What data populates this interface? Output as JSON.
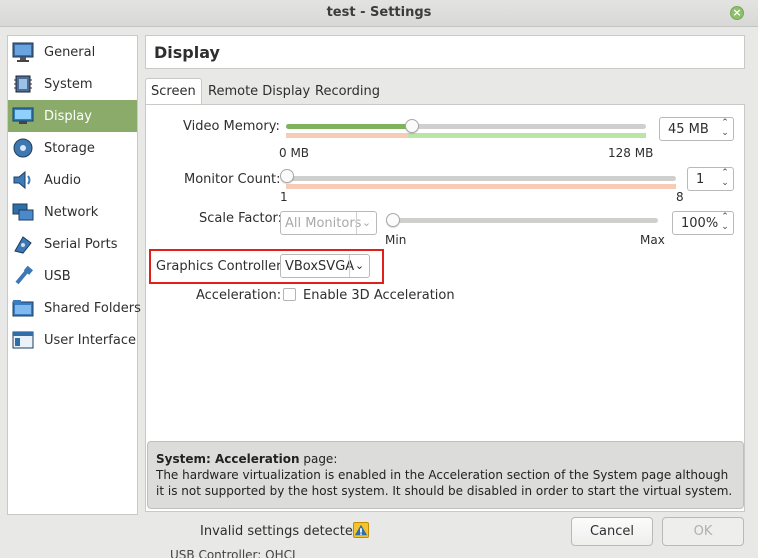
{
  "window": {
    "title": "test - Settings"
  },
  "sidebar": {
    "items": [
      {
        "label": "General",
        "icon": "monitor-icon"
      },
      {
        "label": "System",
        "icon": "chip-icon"
      },
      {
        "label": "Display",
        "icon": "display-icon"
      },
      {
        "label": "Storage",
        "icon": "disk-icon"
      },
      {
        "label": "Audio",
        "icon": "speaker-icon"
      },
      {
        "label": "Network",
        "icon": "network-icon"
      },
      {
        "label": "Serial Ports",
        "icon": "serial-plug-icon"
      },
      {
        "label": "USB",
        "icon": "usb-icon"
      },
      {
        "label": "Shared Folders",
        "icon": "folder-icon"
      },
      {
        "label": "User Interface",
        "icon": "window-icon"
      }
    ],
    "selected": "Display"
  },
  "page": {
    "title": "Display"
  },
  "tabs": [
    {
      "label": "Screen",
      "selected": true
    },
    {
      "label": "Remote Display",
      "selected": false
    },
    {
      "label": "Recording",
      "selected": false
    }
  ],
  "screen": {
    "video_memory": {
      "label": "Video Memory:",
      "value": "45 MB",
      "min_label": "0 MB",
      "max_label": "128 MB",
      "fraction": 0.35
    },
    "monitor_count": {
      "label": "Monitor Count:",
      "value": "1",
      "min_label": "1",
      "max_label": "8",
      "fraction": 0.0
    },
    "scale_factor": {
      "label": "Scale Factor:",
      "monitor_select": "All Monitors",
      "value": "100%",
      "min_label": "Min",
      "max_label": "Max",
      "fraction": 0.0
    },
    "graphics_controller": {
      "label": "Graphics Controller:",
      "value": "VBoxSVGA"
    },
    "acceleration": {
      "label": "Acceleration:",
      "checkbox_label": "Enable 3D Acceleration",
      "checked": false
    }
  },
  "warning": {
    "title": "System: Acceleration",
    "title_suffix": " page:",
    "message": "The hardware virtualization is enabled in the Acceleration section of the System page although it is not supported by the host system. It should be disabled in order to start the virtual system."
  },
  "footer": {
    "status": "Invalid settings detected",
    "cancel_label": "Cancel",
    "ok_label": "OK",
    "behind_text": "USB Controller:   OHCI"
  },
  "colors": {
    "accent": "#8aab6a",
    "highlight": "#e0211a",
    "slider_green": "#7fb35c"
  }
}
